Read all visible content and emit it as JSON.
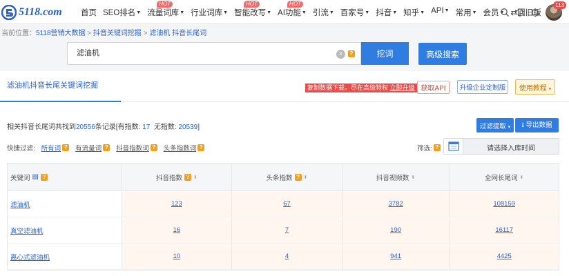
{
  "brand": {
    "logo_text": "5118.com",
    "accent": "#2f7de1",
    "hot_color": "#f06a6a"
  },
  "nav": {
    "items": [
      {
        "label": "首页",
        "dropdown": false,
        "hot": false
      },
      {
        "label": "SEO排名",
        "dropdown": true,
        "hot": false
      },
      {
        "label": "流量词库",
        "dropdown": true,
        "hot": true
      },
      {
        "label": "行业词库",
        "dropdown": true,
        "hot": false
      },
      {
        "label": "智能改写",
        "dropdown": true,
        "hot": true
      },
      {
        "label": "AI功能",
        "dropdown": true,
        "hot": true
      },
      {
        "label": "引流",
        "dropdown": true,
        "hot": false
      },
      {
        "label": "百家号",
        "dropdown": true,
        "hot": false
      },
      {
        "label": "抖音",
        "dropdown": true,
        "hot": false
      },
      {
        "label": "知乎",
        "dropdown": true,
        "hot": false
      },
      {
        "label": "API",
        "dropdown": true,
        "hot": false
      },
      {
        "label": "常用",
        "dropdown": true,
        "hot": false
      },
      {
        "label": "会员",
        "dropdown": true,
        "hot": false
      },
      {
        "label": "⇄回旧版",
        "dropdown": false,
        "hot": false
      }
    ],
    "hot_label": "HOT",
    "notification_count": "113",
    "icons": [
      "search-icon",
      "cloud-download-icon",
      "bell-icon",
      "avatar"
    ]
  },
  "breadcrumb": {
    "prefix": "当前位置：",
    "items": [
      "5118营销大数据",
      "抖音关键词挖掘",
      "滤油机 抖音长尾词"
    ],
    "separator": " > "
  },
  "search": {
    "value": "滤油机",
    "help": "?",
    "dig_label": "挖词",
    "advanced_label": "高级搜索"
  },
  "panel": {
    "tab_label": "滤油机抖音长尾关键词挖掘",
    "promo_text": "复制数据下载，尽在高级特权 ",
    "promo_link": "立即升级",
    "api_label": "获取API",
    "custom_label": "升级企业定制版",
    "tutorial_label": "使用教程",
    "summary": {
      "prefix": "相关抖音长尾词共找到",
      "total": "20556",
      "mid": "条记录[有指数:",
      "indexed": "17",
      "mid2": "无指数:",
      "no_index": "20539",
      "suffix": "]"
    },
    "filter_label": "过滤提取",
    "export_label": "导出数据",
    "quick_filter_label": "快捷过滤:",
    "quick_filters": [
      "所有词",
      "有流量词",
      "抖音指数词",
      "头条指数词"
    ],
    "screen_label": "筛选:",
    "date_select_label": "请选择入库时间"
  },
  "table": {
    "headers": [
      "关键词",
      "抖音指数",
      "头条指数",
      "抖音视频数",
      "全网长尾词"
    ],
    "rows": [
      [
        "滤油机",
        "123",
        "67",
        "3782",
        "108159"
      ],
      [
        "真空滤油机",
        "16",
        "7",
        "190",
        "16117"
      ],
      [
        "离心式滤油机",
        "10",
        "4",
        "941",
        "4425"
      ]
    ]
  }
}
